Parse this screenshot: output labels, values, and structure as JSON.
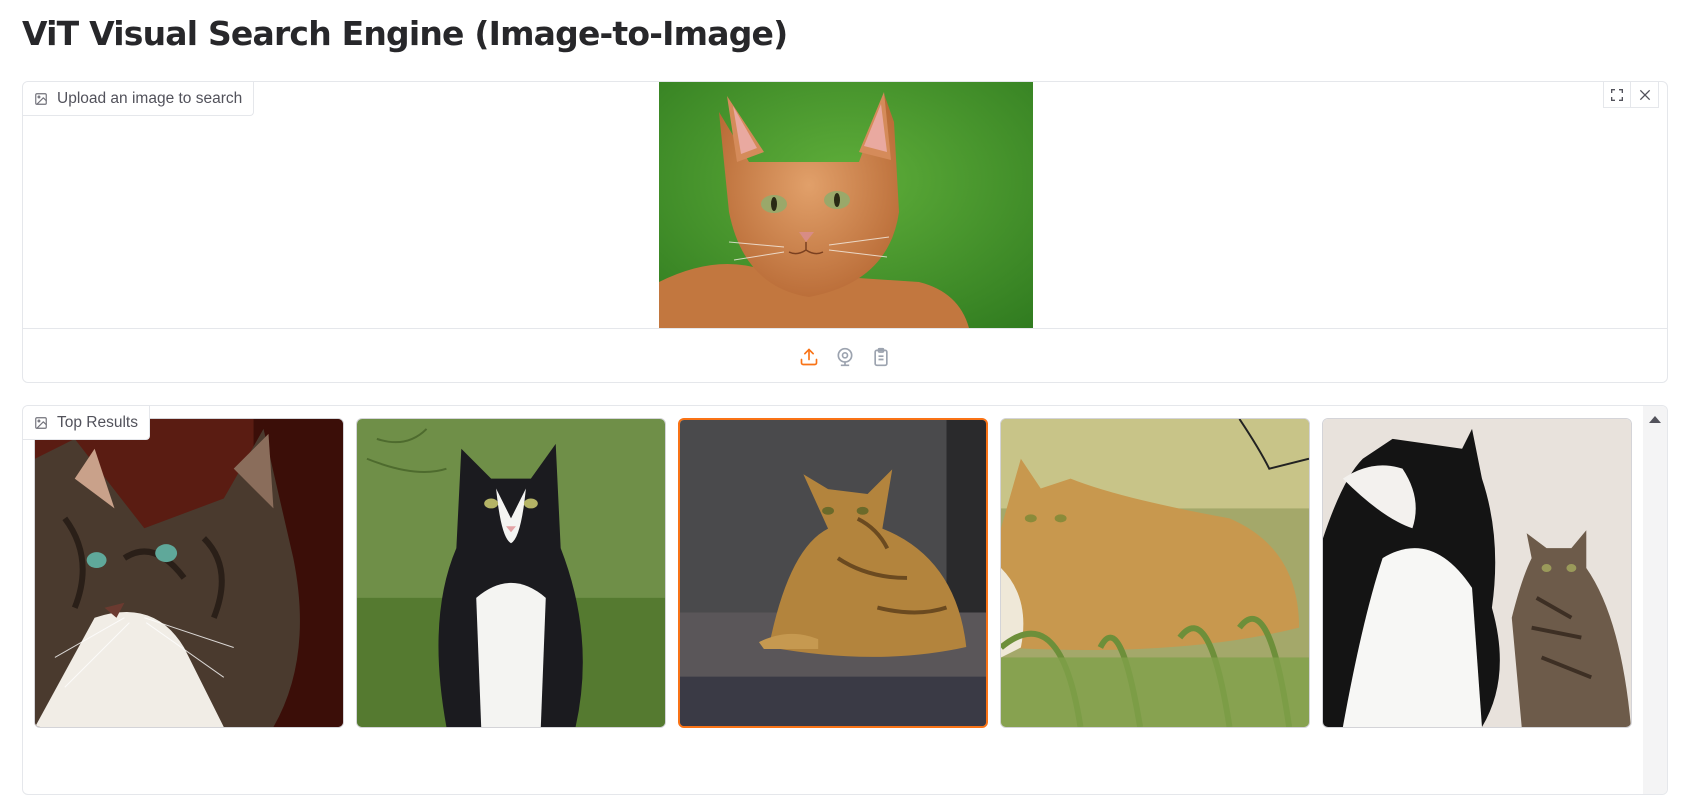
{
  "page": {
    "title": "ViT Visual Search Engine (Image-to-Image)"
  },
  "upload": {
    "label": "Upload an image to search",
    "label_icon": "image-icon",
    "preview_alt": "orange tabby cat on green background",
    "sources": [
      "upload-icon",
      "webcam-icon",
      "clipboard-icon"
    ],
    "corner_buttons": [
      "fullscreen-icon",
      "close-icon"
    ]
  },
  "results": {
    "label": "Top Results",
    "label_icon": "image-icon",
    "items": [
      {
        "description": "brown tabby cat with white chest, dark red background"
      },
      {
        "description": "black and white cat sitting on grass"
      },
      {
        "description": "orange tabby cat lying on grey cushion",
        "selected": true
      },
      {
        "description": "ginger cat lying in grass"
      },
      {
        "description": "black and white cat looking up with tabby cat"
      }
    ]
  },
  "colors": {
    "accent": "#f97316",
    "border": "#e5e7eb",
    "text": "#27272a",
    "label": "#52525b"
  }
}
